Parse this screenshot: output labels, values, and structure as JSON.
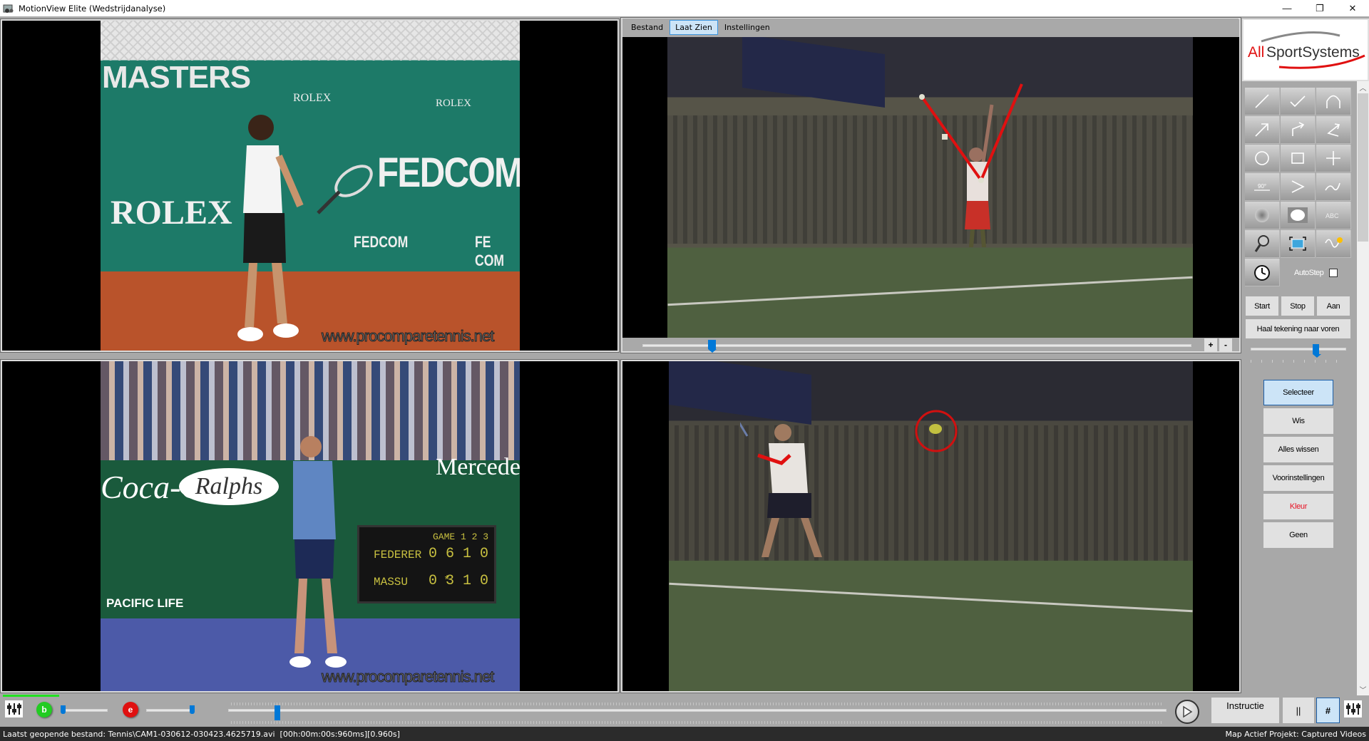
{
  "window": {
    "title": "MotionView Elite (Wedstrijdanalyse)",
    "controls": {
      "minimize": "—",
      "maximize": "❐",
      "close": "✕"
    }
  },
  "menu": {
    "items": [
      "Bestand",
      "Laat Zien",
      "Instellingen"
    ],
    "active_index": 1
  },
  "videos": {
    "top_left": {
      "description": "Clay court player in ready position",
      "banner_texts": [
        "MASTERS",
        "ROLEX",
        "ROLEX",
        "FEDCOM",
        "ROLEX",
        "FEDCOM",
        "FE COM"
      ],
      "watermark": "www.procomparetennis.net"
    },
    "bottom_left": {
      "description": "Hard court player during match",
      "banner_texts": [
        "Coca-Cola",
        "Ralphs",
        "Mercedes",
        "PACIFIC LIFE"
      ],
      "scoreboard": {
        "header": "GAME 1 2 3",
        "rows": [
          {
            "name": "FEDERER",
            "score": "0 6 1 0"
          },
          {
            "name": "MASSU",
            "serve": "*",
            "score": "0 3 1 0"
          }
        ]
      },
      "watermark": "www.procomparetennis.net"
    },
    "top_right": {
      "description": "Indoor serve with angle drawing annotation",
      "annotation_color": "#e01010"
    },
    "bottom_right": {
      "description": "Indoor forehand with ball circle annotation",
      "annotation_color": "#e01010"
    }
  },
  "top_right_slider": {
    "value_fraction": 0.12,
    "plus_label": "+",
    "minus_label": "-"
  },
  "tools": {
    "icons": [
      "line-tool",
      "checkmark-tool",
      "arc-tool",
      "arrow-tool",
      "polyline-arrow-tool",
      "angle-arrow-tool",
      "circle-tool",
      "rectangle-tool",
      "crosshair-tool",
      "angle-90-tool",
      "angle-tool",
      "freehand-curve-tool",
      "spotlight-tool",
      "ellipse-fill-tool",
      "text-tool",
      "magnifier-tool",
      "frame-tool",
      "trajectory-tool",
      "stopwatch-tool"
    ],
    "angle_label": "90°",
    "text_label": "ABC",
    "autostep_label": "AutoStep",
    "autostep_checked": false
  },
  "timer_buttons": [
    "Start",
    "Stop",
    "Aan"
  ],
  "bring_front_label": "Haal tekening naar voren",
  "opacity_slider": {
    "value_fraction": 0.68
  },
  "action_buttons": [
    {
      "label": "Selecteer",
      "selected": true
    },
    {
      "label": "Wis"
    },
    {
      "label": "Alles wissen"
    },
    {
      "label": "Voorinstellingen"
    },
    {
      "label": "Kleur",
      "color": "#e81123"
    },
    {
      "label": "Geen"
    }
  ],
  "bottom": {
    "begin_marker": "b",
    "end_marker": "e",
    "begin_color": "#22cc22",
    "end_color": "#e01010",
    "begin_slider_fraction": 0.0,
    "end_slider_fraction": 1.0,
    "timeline_fraction": 0.05,
    "instructie_label": "Instructie",
    "pause_label": "||",
    "grid_label": "#"
  },
  "status": {
    "left": "Laatst geopende bestand: Tennis\\CAM1-030612-030423.4625719.avi  [00h:00m:00s:960ms][0.960s]",
    "right": "Map Actief Projekt: Captured Videos"
  },
  "colors": {
    "accent": "#0078d7",
    "selected_bg": "#cce4f7",
    "panel_bg": "#a8a8a8",
    "status_bg": "#2b2b2b"
  }
}
